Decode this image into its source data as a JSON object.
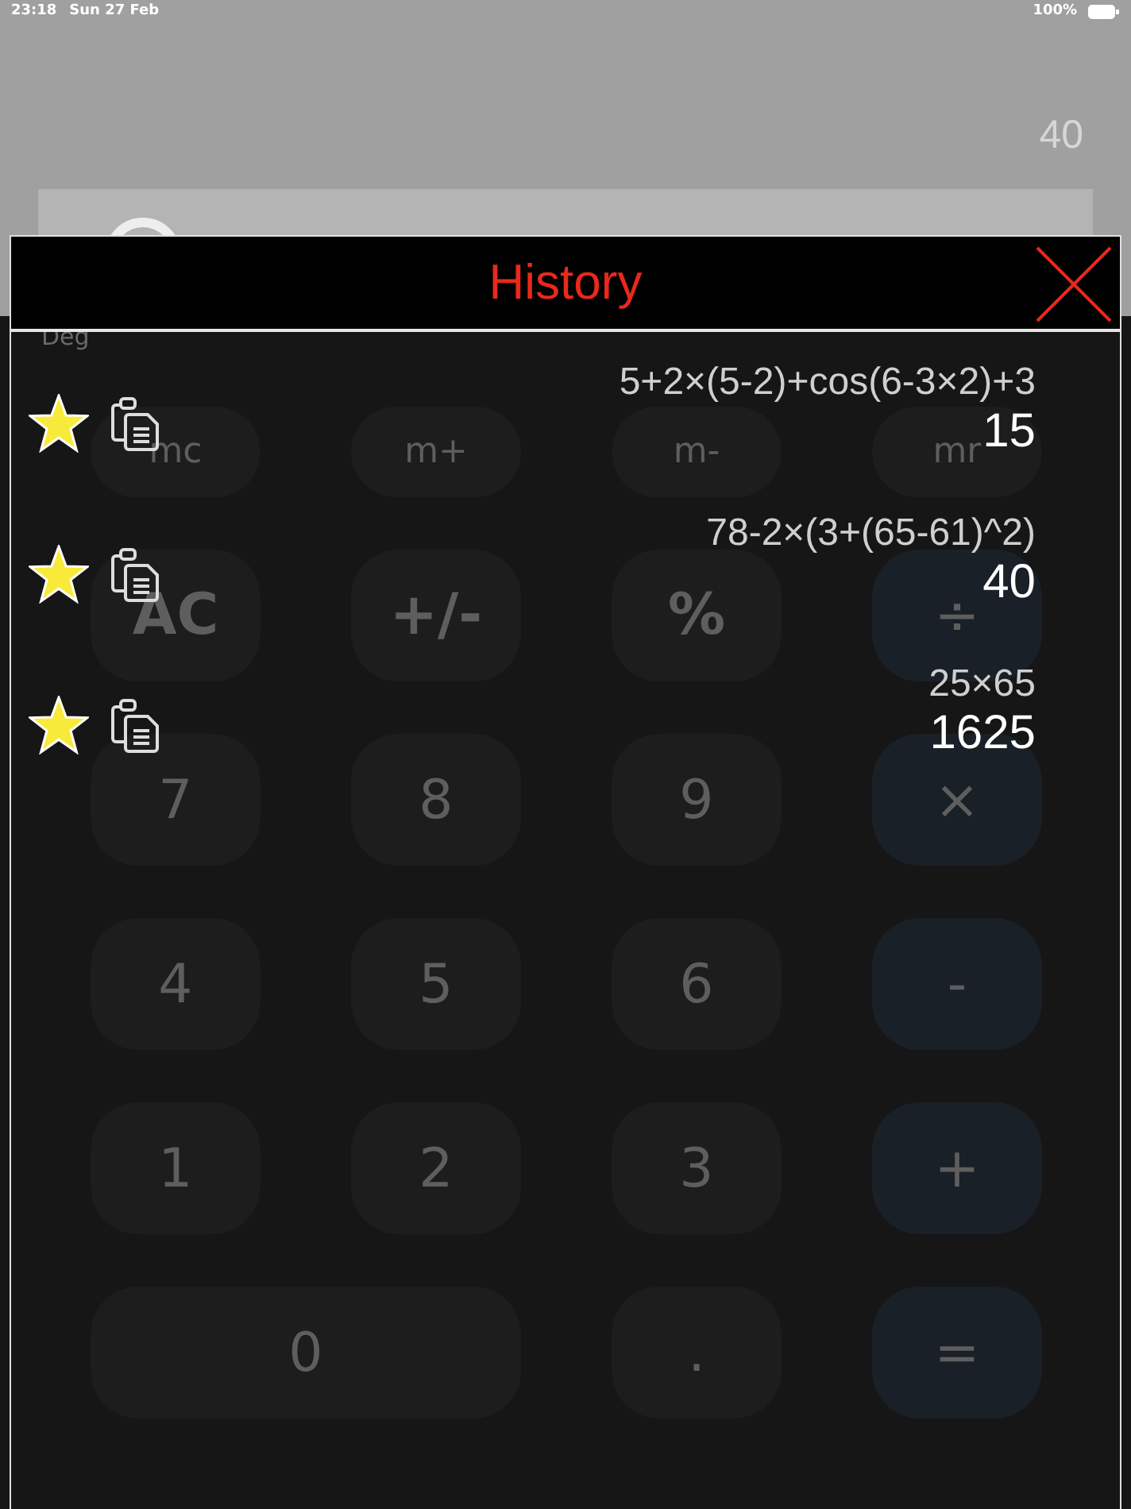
{
  "status_bar": {
    "time": "23:18",
    "date": "Sun 27 Feb",
    "battery": "100%"
  },
  "calculator": {
    "previous_value": "40",
    "angle_mode": "Deg",
    "keys": [
      {
        "label": "mc",
        "kind": "memory"
      },
      {
        "label": "m+",
        "kind": "memory"
      },
      {
        "label": "m-",
        "kind": "memory"
      },
      {
        "label": "mr",
        "kind": "memory"
      },
      {
        "label": "AC",
        "kind": "function"
      },
      {
        "label": "+/-",
        "kind": "function"
      },
      {
        "label": "%",
        "kind": "function"
      },
      {
        "label": "÷",
        "kind": "operator"
      },
      {
        "label": "7",
        "kind": "digit"
      },
      {
        "label": "8",
        "kind": "digit"
      },
      {
        "label": "9",
        "kind": "digit"
      },
      {
        "label": "×",
        "kind": "operator"
      },
      {
        "label": "4",
        "kind": "digit"
      },
      {
        "label": "5",
        "kind": "digit"
      },
      {
        "label": "6",
        "kind": "digit"
      },
      {
        "label": "-",
        "kind": "operator"
      },
      {
        "label": "1",
        "kind": "digit"
      },
      {
        "label": "2",
        "kind": "digit"
      },
      {
        "label": "3",
        "kind": "digit"
      },
      {
        "label": "+",
        "kind": "operator"
      },
      {
        "label": "0",
        "kind": "wide"
      },
      {
        "label": ".",
        "kind": "digit"
      },
      {
        "label": "=",
        "kind": "operator"
      }
    ]
  },
  "history": {
    "title": "History",
    "entries": [
      {
        "expression": "5+2×(5-2)+cos(6-3×2)+3",
        "result": "15",
        "favorite": true
      },
      {
        "expression": "78-2×(3+(65-61)^2)",
        "result": "40",
        "favorite": true
      },
      {
        "expression": "25×65",
        "result": "1625",
        "favorite": true
      }
    ]
  }
}
